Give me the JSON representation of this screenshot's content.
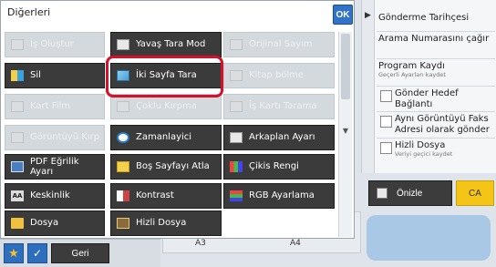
{
  "dialog": {
    "title": "Diğerleri",
    "ok_label": "OK"
  },
  "functions": [
    {
      "label": "İş Oluştur",
      "icon": "job-build-icon",
      "enabled": false
    },
    {
      "label": "Yavaş Tara Mod",
      "icon": "slow-scan-icon",
      "enabled": true
    },
    {
      "label": "Orijinal Sayım",
      "icon": "original-count-icon",
      "enabled": false
    },
    {
      "label": "Sil",
      "icon": "erase-icon",
      "enabled": true
    },
    {
      "label": "İki Sayfa Tara",
      "icon": "dual-page-scan-icon",
      "enabled": true
    },
    {
      "label": "Kitap bölme",
      "icon": "book-divide-icon",
      "enabled": false
    },
    {
      "label": "Kart Film",
      "icon": "card-shot-icon",
      "enabled": false
    },
    {
      "label": "Çoklu Kırpma",
      "icon": "multi-crop-icon",
      "enabled": false
    },
    {
      "label": "İş Kartı Tarama",
      "icon": "business-card-icon",
      "enabled": false
    },
    {
      "label": "Görüntüyü Kırp",
      "icon": "image-crop-icon",
      "enabled": false
    },
    {
      "label": "Zamanlayici",
      "icon": "clock-icon",
      "enabled": true
    },
    {
      "label": "Arkaplan Ayarı",
      "icon": "background-icon",
      "enabled": true
    },
    {
      "label": "PDF Eğrilik Ayarı",
      "icon": "pdf-skew-icon",
      "enabled": true
    },
    {
      "label": "Boş Sayfayı Atla",
      "icon": "blank-page-skip-icon",
      "enabled": true
    },
    {
      "label": "Çikis Rengi",
      "icon": "output-color-icon",
      "enabled": true
    },
    {
      "label": "Keskinlik",
      "icon": "sharpness-icon",
      "enabled": true
    },
    {
      "label": "Kontrast",
      "icon": "contrast-icon",
      "enabled": true
    },
    {
      "label": "RGB Ayarlama",
      "icon": "rgb-adjust-icon",
      "enabled": true
    },
    {
      "label": "Dosya",
      "icon": "folder-icon",
      "enabled": true
    },
    {
      "label": "Hizli Dosya",
      "icon": "quick-file-icon",
      "enabled": true
    }
  ],
  "right_panel": {
    "items": [
      {
        "label": "Gönderme Tarihçesi",
        "sub": ""
      },
      {
        "label": "Arama Numarasını çağır",
        "sub": ""
      },
      {
        "label": "Program Kaydı",
        "sub": "Geçerli Ayarları kaydet"
      },
      {
        "label": "Gönder Hedef Bağlantı",
        "sub": ""
      },
      {
        "label": "Aynı Görüntüyü Faks Adresi olarak gönder",
        "sub": ""
      },
      {
        "label": "Hizli Dosya",
        "sub": "Veriyi geçici kaydet"
      }
    ]
  },
  "actions": {
    "preview_label": "Önizle",
    "ca_label": "CA",
    "back_label": "Geri"
  },
  "background": {
    "paper_left": "A3",
    "paper_right": "A4"
  },
  "colors": {
    "highlight": "#d4102a",
    "ok": "#2f74c8",
    "ca": "#f4c516",
    "button_dark": "#3b3b3b"
  }
}
